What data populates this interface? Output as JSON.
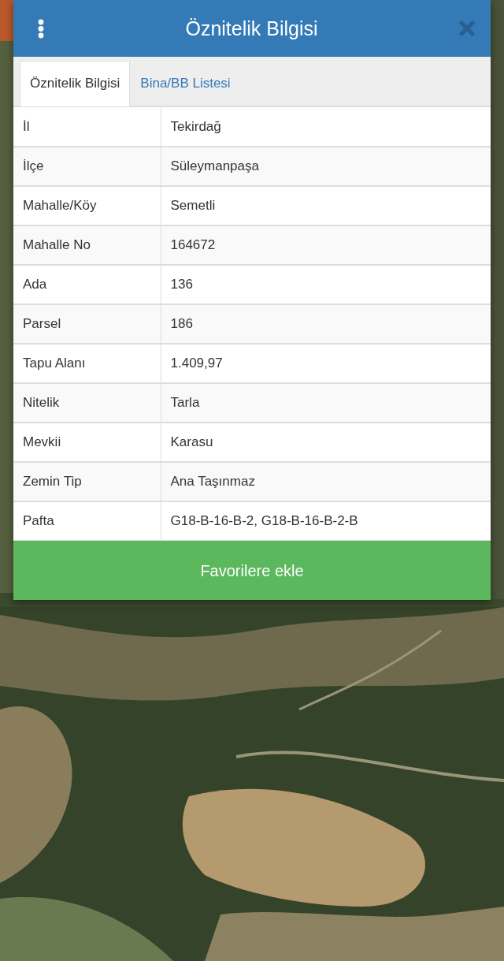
{
  "header": {
    "title": "Öznitelik Bilgisi"
  },
  "tabs": [
    {
      "label": "Öznitelik Bilgisi",
      "selected": true
    },
    {
      "label": "Bina/BB Listesi",
      "selected": false
    }
  ],
  "attributes": [
    {
      "label": "İl",
      "value": "Tekirdağ"
    },
    {
      "label": "İlçe",
      "value": "Süleymanpaşa"
    },
    {
      "label": "Mahalle/Köy",
      "value": "Semetli"
    },
    {
      "label": "Mahalle No",
      "value": "164672"
    },
    {
      "label": "Ada",
      "value": "136"
    },
    {
      "label": "Parsel",
      "value": "186"
    },
    {
      "label": "Tapu Alanı",
      "value": "1.409,97"
    },
    {
      "label": "Nitelik",
      "value": "Tarla"
    },
    {
      "label": "Mevkii",
      "value": "Karasu"
    },
    {
      "label": "Zemin Tip",
      "value": "Ana Taşınmaz"
    },
    {
      "label": "Pafta",
      "value": "G18-B-16-B-2, G18-B-16-B-2-B"
    }
  ],
  "button": {
    "label": "Favorilere ekle"
  }
}
